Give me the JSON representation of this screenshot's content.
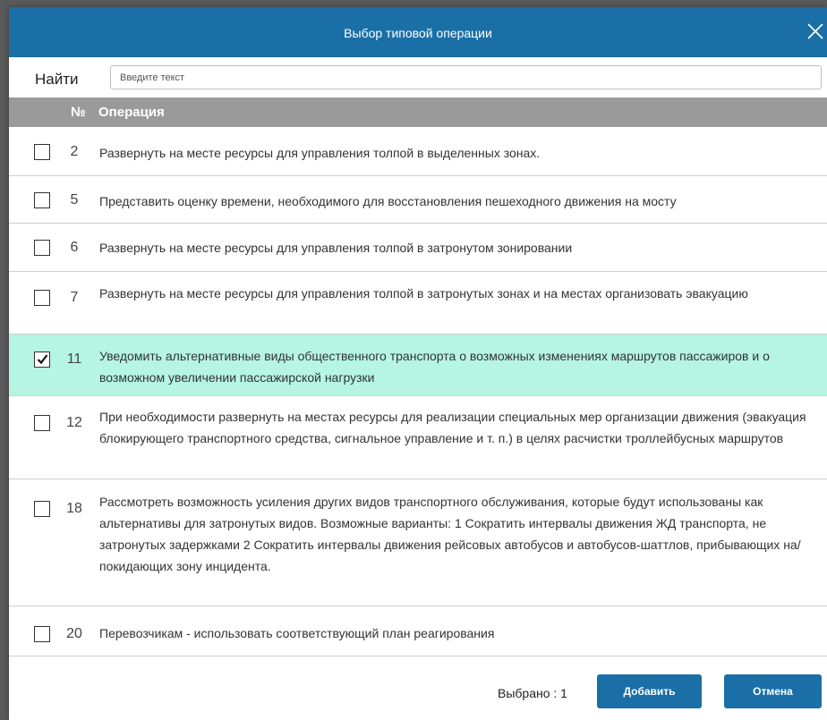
{
  "dialog": {
    "title": "Выбор типовой операции",
    "close_icon": "close-icon"
  },
  "search": {
    "label": "Найти",
    "value": "",
    "placeholder": "Введите текст"
  },
  "table": {
    "columns": [
      "№",
      "Операция"
    ],
    "rows": [
      {
        "num": "2",
        "text": "Развернуть на месте ресурсы для управления толпой в выделенных зонах.",
        "checked": false
      },
      {
        "num": "5",
        "text": "Представить оценку времени, необходимого для восстановления пешеходного движения на мосту",
        "checked": false
      },
      {
        "num": "6",
        "text": "Развернуть на месте ресурсы для управления толпой в затронутом зонировании",
        "checked": false
      },
      {
        "num": "7",
        "text": "Развернуть на месте ресурсы для управления толпой в затронутых зонах и на местах организовать эвакуацию",
        "checked": false
      },
      {
        "num": "11",
        "text": "Уведомить альтернативные виды общественного транспорта о возможных изменениях маршрутов пассажиров и о возможном увеличении пассажирской нагрузки",
        "checked": true
      },
      {
        "num": "12",
        "text": "При необходимости развернуть на местах ресурсы для реализации специальных мер организации движения (эвакуация блокирующего транспортного средства, сигнальное управление и т. п.) в целях расчистки троллейбусных маршрутов",
        "checked": false
      },
      {
        "num": "18",
        "text": "Рассмотреть возможность усиления других видов транспортного обслуживания, которые будут использованы как альтернативы для затронутых видов. Возможные варианты: 1 Сократить интервалы движения ЖД транспорта, не затронутых задержками 2 Сократить интервалы движения рейсовых автобусов и автобусов-шаттлов, прибывающих на/покидающих зону инцидента.",
        "checked": false
      },
      {
        "num": "20",
        "text": "Перевозчикам - использовать соответствующий план реагирования",
        "checked": false
      }
    ]
  },
  "footer": {
    "selected_count": "Выбрано : 1",
    "add_label": "Добавить",
    "cancel_label": "Отмена"
  },
  "colors": {
    "accent": "#1a6fa6",
    "header_gray": "#9a9a9a",
    "selected_row": "#b5f5e2"
  }
}
